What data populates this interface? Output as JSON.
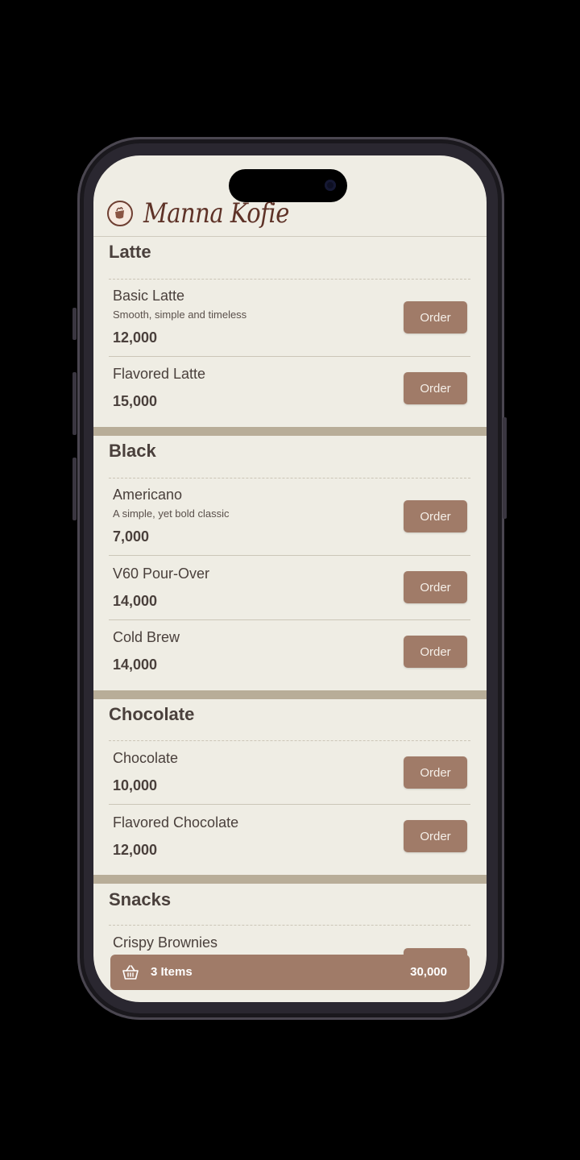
{
  "brand": {
    "name": "Manna Kofie",
    "logo_icon": "coffee-cup-logo"
  },
  "colors": {
    "accent": "#a07b68",
    "background": "#efede4",
    "text": "#4a403c",
    "band": "#b8ad98",
    "brand_text": "#5e3227"
  },
  "menu": {
    "order_label": "Order",
    "sections": [
      {
        "title": "Latte",
        "items": [
          {
            "name": "Basic Latte",
            "desc": "Smooth, simple and timeless",
            "price": "12,000"
          },
          {
            "name": "Flavored Latte",
            "price": "15,000"
          }
        ]
      },
      {
        "title": "Black",
        "items": [
          {
            "name": "Americano",
            "desc": "A simple, yet bold classic",
            "price": "7,000"
          },
          {
            "name": "V60 Pour-Over",
            "price": "14,000"
          },
          {
            "name": "Cold Brew",
            "price": "14,000"
          }
        ]
      },
      {
        "title": "Chocolate",
        "items": [
          {
            "name": "Chocolate",
            "price": "10,000"
          },
          {
            "name": "Flavored Chocolate",
            "price": "12,000"
          }
        ]
      },
      {
        "title": "Snacks",
        "items": [
          {
            "name": "Crispy Brownies"
          }
        ]
      }
    ]
  },
  "cart": {
    "icon": "basket-icon",
    "count_label": "3 Items",
    "total": "30,000"
  }
}
